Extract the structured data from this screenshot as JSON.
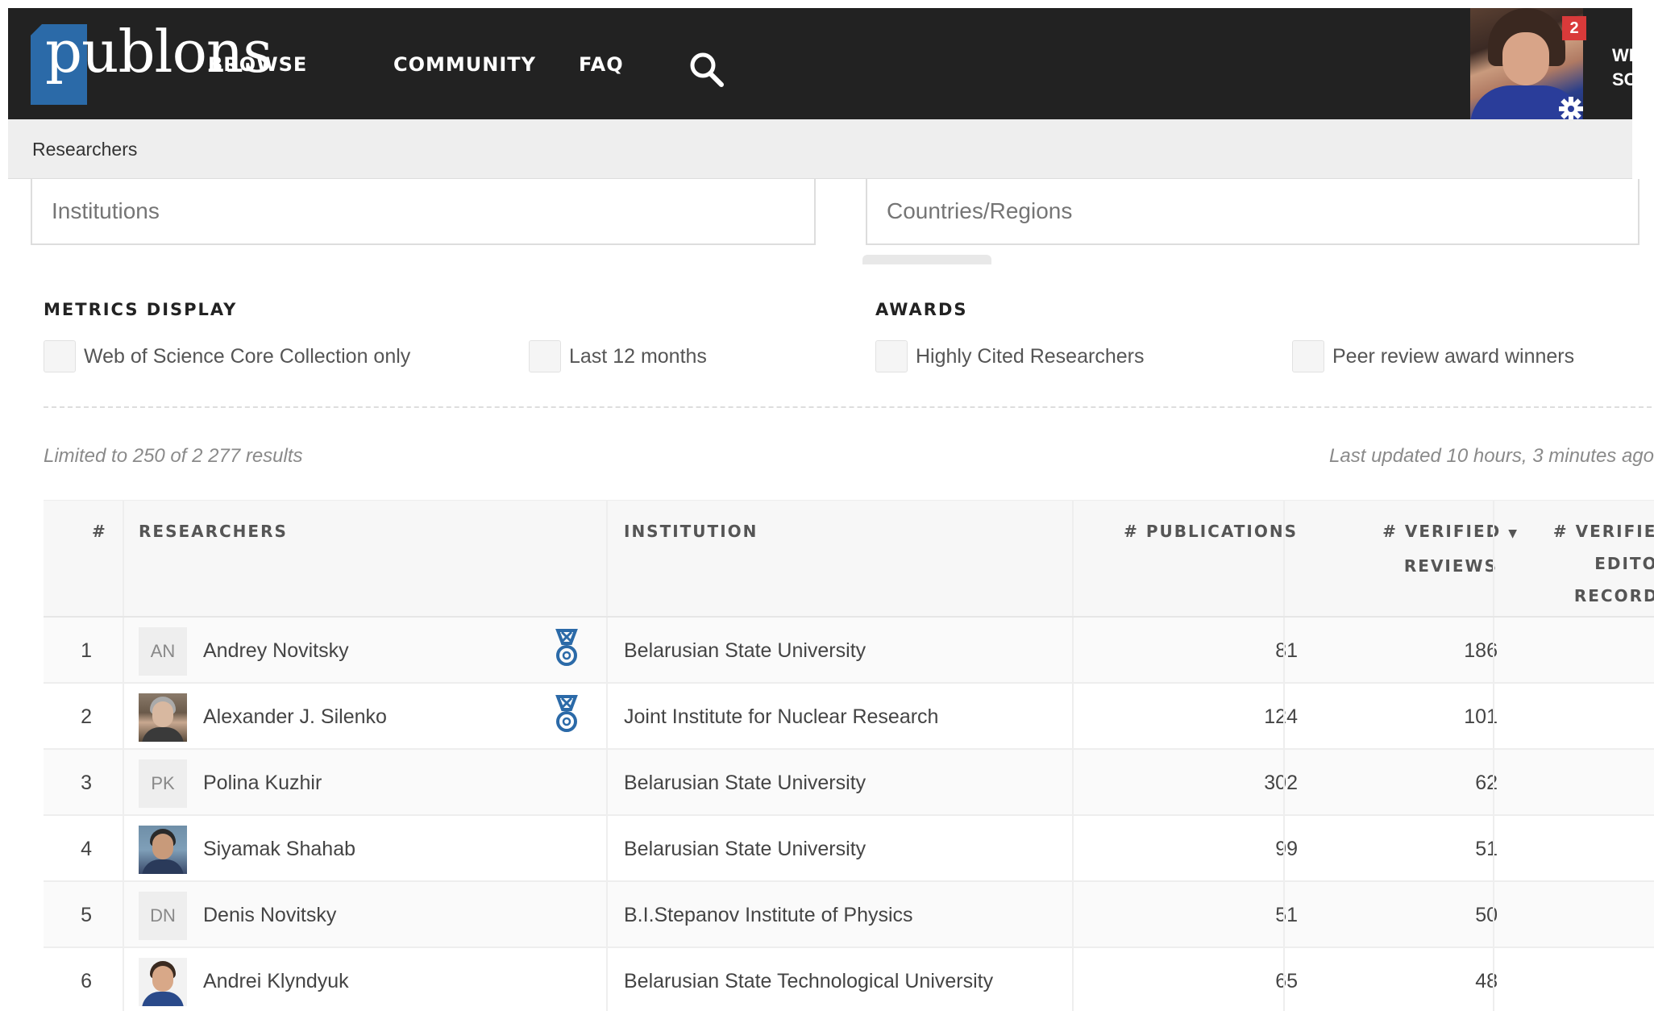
{
  "brand": {
    "logo_text": "publons",
    "colors": {
      "nav_bg": "#222222",
      "logo_blue": "#2b6aa8",
      "award_blue": "#2b6aa8",
      "badge_red": "#d93a3a"
    }
  },
  "nav": {
    "items": [
      "BROWSE",
      "COMMUNITY",
      "FAQ"
    ],
    "search_icon": "search-icon"
  },
  "user": {
    "notification_count": "2",
    "name_fragment": "WE SC",
    "name_line1": "WE",
    "name_line2": "SC"
  },
  "breadcrumb": {
    "label": "Researchers"
  },
  "filters": {
    "institutions_placeholder": "Institutions",
    "countries_placeholder": "Countries/Regions"
  },
  "metrics_display": {
    "label": "METRICS DISPLAY",
    "options": [
      "Web of Science Core Collection only",
      "Last 12 months"
    ]
  },
  "awards": {
    "label": "AWARDS",
    "options": [
      "Highly Cited Researchers",
      "Peer review award winners"
    ]
  },
  "results": {
    "count_text": "Limited to 250 of 2 277 results",
    "updated_text": "Last updated 10 hours, 3 minutes ago"
  },
  "table": {
    "headers": {
      "rank": "#",
      "researchers": "RESEARCHERS",
      "institution": "INSTITUTION",
      "publications": "# PUBLICATIONS",
      "verified_reviews_1": "# VERIFIED",
      "verified_reviews_sort": "▼",
      "verified_reviews_2": "REVIEWS",
      "verified_editor_1": "# VERIFIED",
      "verified_editor_2": "EDITOR",
      "verified_editor_3": "RECORDS"
    },
    "rows": [
      {
        "rank": "1",
        "initials": "AN",
        "name": "Andrey Novitsky",
        "award": true,
        "institution": "Belarusian State University",
        "publications": "81",
        "reviews": "186",
        "editor": "-"
      },
      {
        "rank": "2",
        "initials": "",
        "name": "Alexander J. Silenko",
        "award": true,
        "institution": "Joint Institute for Nuclear Research",
        "publications": "124",
        "reviews": "101",
        "editor": "-"
      },
      {
        "rank": "3",
        "initials": "PK",
        "name": "Polina Kuzhir",
        "award": false,
        "institution": "Belarusian State University",
        "publications": "302",
        "reviews": "62",
        "editor": "-"
      },
      {
        "rank": "4",
        "initials": "",
        "name": "Siyamak Shahab",
        "award": false,
        "institution": "Belarusian State University",
        "publications": "99",
        "reviews": "51",
        "editor": "-"
      },
      {
        "rank": "5",
        "initials": "DN",
        "name": "Denis Novitsky",
        "award": false,
        "institution": "B.I.Stepanov Institute of Physics",
        "publications": "51",
        "reviews": "50",
        "editor": "-"
      },
      {
        "rank": "6",
        "initials": "",
        "name": "Andrei Klyndyuk",
        "award": false,
        "institution": "Belarusian State Technological University",
        "publications": "65",
        "reviews": "48",
        "editor": "-"
      }
    ]
  }
}
